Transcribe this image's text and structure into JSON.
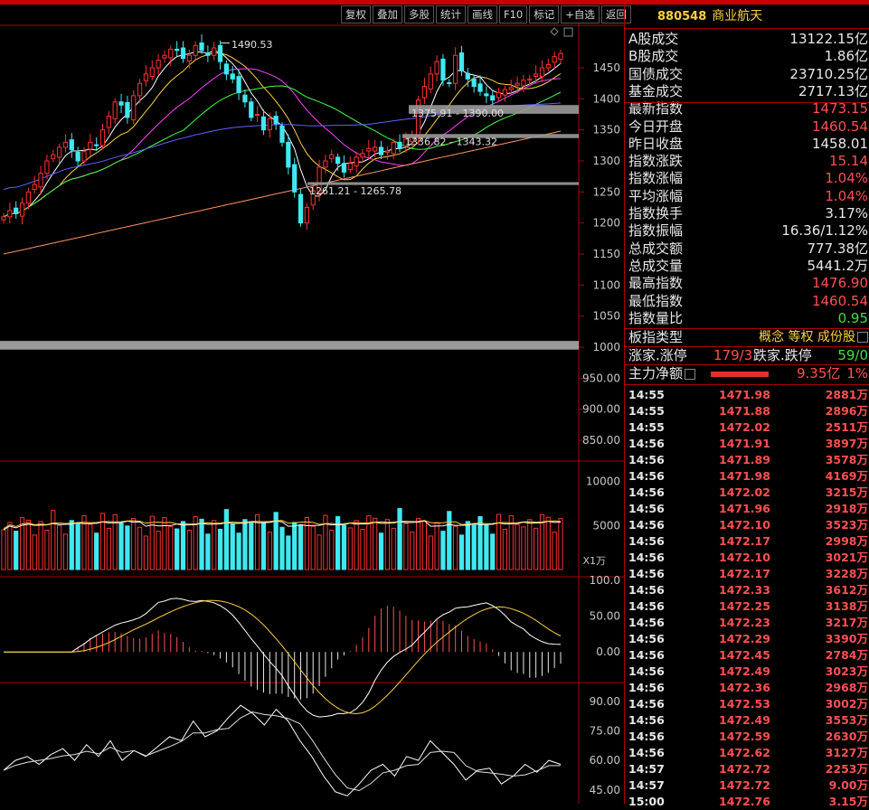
{
  "toolbar": {
    "buttons": [
      "复权",
      "叠加",
      "多股",
      "统计",
      "画线",
      "F10",
      "标记",
      "+自选",
      "返回"
    ]
  },
  "index": {
    "code": "880548",
    "name": "商业航天"
  },
  "stats": [
    {
      "label": "A股成交",
      "value": "13122.15亿",
      "color": "#e8e8e8"
    },
    {
      "label": "B股成交",
      "value": "1.86亿",
      "color": "#e8e8e8"
    },
    {
      "label": "国债成交",
      "value": "23710.25亿",
      "color": "#e8e8e8"
    },
    {
      "label": "基金成交",
      "value": "2717.13亿",
      "color": "#e8e8e8"
    },
    {
      "label": "最新指数",
      "value": "1473.15",
      "color": "#ff5050"
    },
    {
      "label": "今日开盘",
      "value": "1460.54",
      "color": "#ff5050"
    },
    {
      "label": "昨日收盘",
      "value": "1458.01",
      "color": "#e8e8e8"
    },
    {
      "label": "指数涨跌",
      "value": "15.14",
      "color": "#ff5050"
    },
    {
      "label": "指数涨幅",
      "value": "1.04%",
      "color": "#ff5050"
    },
    {
      "label": "平均涨幅",
      "value": "1.04%",
      "color": "#ff5050"
    },
    {
      "label": "指数换手",
      "value": "3.17%",
      "color": "#e8e8e8"
    },
    {
      "label": "指数振幅",
      "value": "16.36/1.12%",
      "color": "#e8e8e8"
    },
    {
      "label": "总成交额",
      "value": "777.38亿",
      "color": "#e8e8e8"
    },
    {
      "label": "总成交量",
      "value": "5441.2万",
      "color": "#e8e8e8"
    },
    {
      "label": "最高指数",
      "value": "1476.90",
      "color": "#ff5050"
    },
    {
      "label": "最低指数",
      "value": "1460.54",
      "color": "#ff5050"
    },
    {
      "label": "指数量比",
      "value": "0.95",
      "color": "#40e040"
    }
  ],
  "board": {
    "label": "板指类型",
    "tags": "概念 等权 成份股"
  },
  "updown": {
    "up_label": "涨家.涨停",
    "up_value": "179/3",
    "down_label": "跌家.跌停",
    "down_value": "59/0"
  },
  "mainflow": {
    "label": "主力净额",
    "value": "9.35亿",
    "pct": "1%",
    "fill": 0.8
  },
  "ticks": [
    {
      "t": "14:55",
      "p": "1471.98",
      "v": "2881万"
    },
    {
      "t": "14:55",
      "p": "1471.88",
      "v": "2896万"
    },
    {
      "t": "14:55",
      "p": "1472.02",
      "v": "2511万"
    },
    {
      "t": "14:56",
      "p": "1471.91",
      "v": "3897万"
    },
    {
      "t": "14:56",
      "p": "1471.89",
      "v": "3578万"
    },
    {
      "t": "14:56",
      "p": "1471.98",
      "v": "4169万"
    },
    {
      "t": "14:56",
      "p": "1472.02",
      "v": "3215万"
    },
    {
      "t": "14:56",
      "p": "1471.96",
      "v": "2918万"
    },
    {
      "t": "14:56",
      "p": "1472.10",
      "v": "3523万"
    },
    {
      "t": "14:56",
      "p": "1472.17",
      "v": "2998万"
    },
    {
      "t": "14:56",
      "p": "1472.10",
      "v": "3021万"
    },
    {
      "t": "14:56",
      "p": "1472.17",
      "v": "3228万"
    },
    {
      "t": "14:56",
      "p": "1472.33",
      "v": "3612万"
    },
    {
      "t": "14:56",
      "p": "1472.25",
      "v": "3138万"
    },
    {
      "t": "14:56",
      "p": "1472.23",
      "v": "3217万"
    },
    {
      "t": "14:56",
      "p": "1472.29",
      "v": "3390万"
    },
    {
      "t": "14:56",
      "p": "1472.45",
      "v": "2784万"
    },
    {
      "t": "14:56",
      "p": "1472.49",
      "v": "3023万"
    },
    {
      "t": "14:56",
      "p": "1472.36",
      "v": "2968万"
    },
    {
      "t": "14:56",
      "p": "1472.53",
      "v": "3002万"
    },
    {
      "t": "14:56",
      "p": "1472.49",
      "v": "3553万"
    },
    {
      "t": "14:56",
      "p": "1472.59",
      "v": "2630万"
    },
    {
      "t": "14:56",
      "p": "1472.62",
      "v": "3127万"
    },
    {
      "t": "14:57",
      "p": "1472.72",
      "v": "2253万"
    },
    {
      "t": "14:57",
      "p": "1472.72",
      "v": "9.00万"
    },
    {
      "t": "15:00",
      "p": "1472.76",
      "v": "3.15万"
    }
  ],
  "main_chart": {
    "y_ticks": [
      850,
      900,
      950,
      1000,
      1050,
      1100,
      1150,
      1200,
      1250,
      1300,
      1350,
      1400,
      1450
    ],
    "tick_labels": [
      "850.00",
      "900.00",
      "950.00",
      "1000",
      "1050",
      "1100",
      "1150",
      "1200",
      "1250",
      "1300",
      "1350",
      "1400",
      "1450"
    ],
    "annotations": {
      "high": "1490.53",
      "low": "1261.21 - 1265.78",
      "gap1": "1375.91 - 1390.00",
      "gap2": "1336.82 - 1343.32"
    },
    "candle_up_color": "#ff3030",
    "candle_down_color": "#40e8f0"
  },
  "volume": {
    "ticks": [
      "10000",
      "5000"
    ],
    "unit": "X1万"
  },
  "macd": {
    "ticks": [
      "100.0",
      "50.00",
      "0.00"
    ]
  },
  "kdj": {
    "ticks": [
      "90.00",
      "75.00",
      "60.00",
      "45.00"
    ]
  }
}
